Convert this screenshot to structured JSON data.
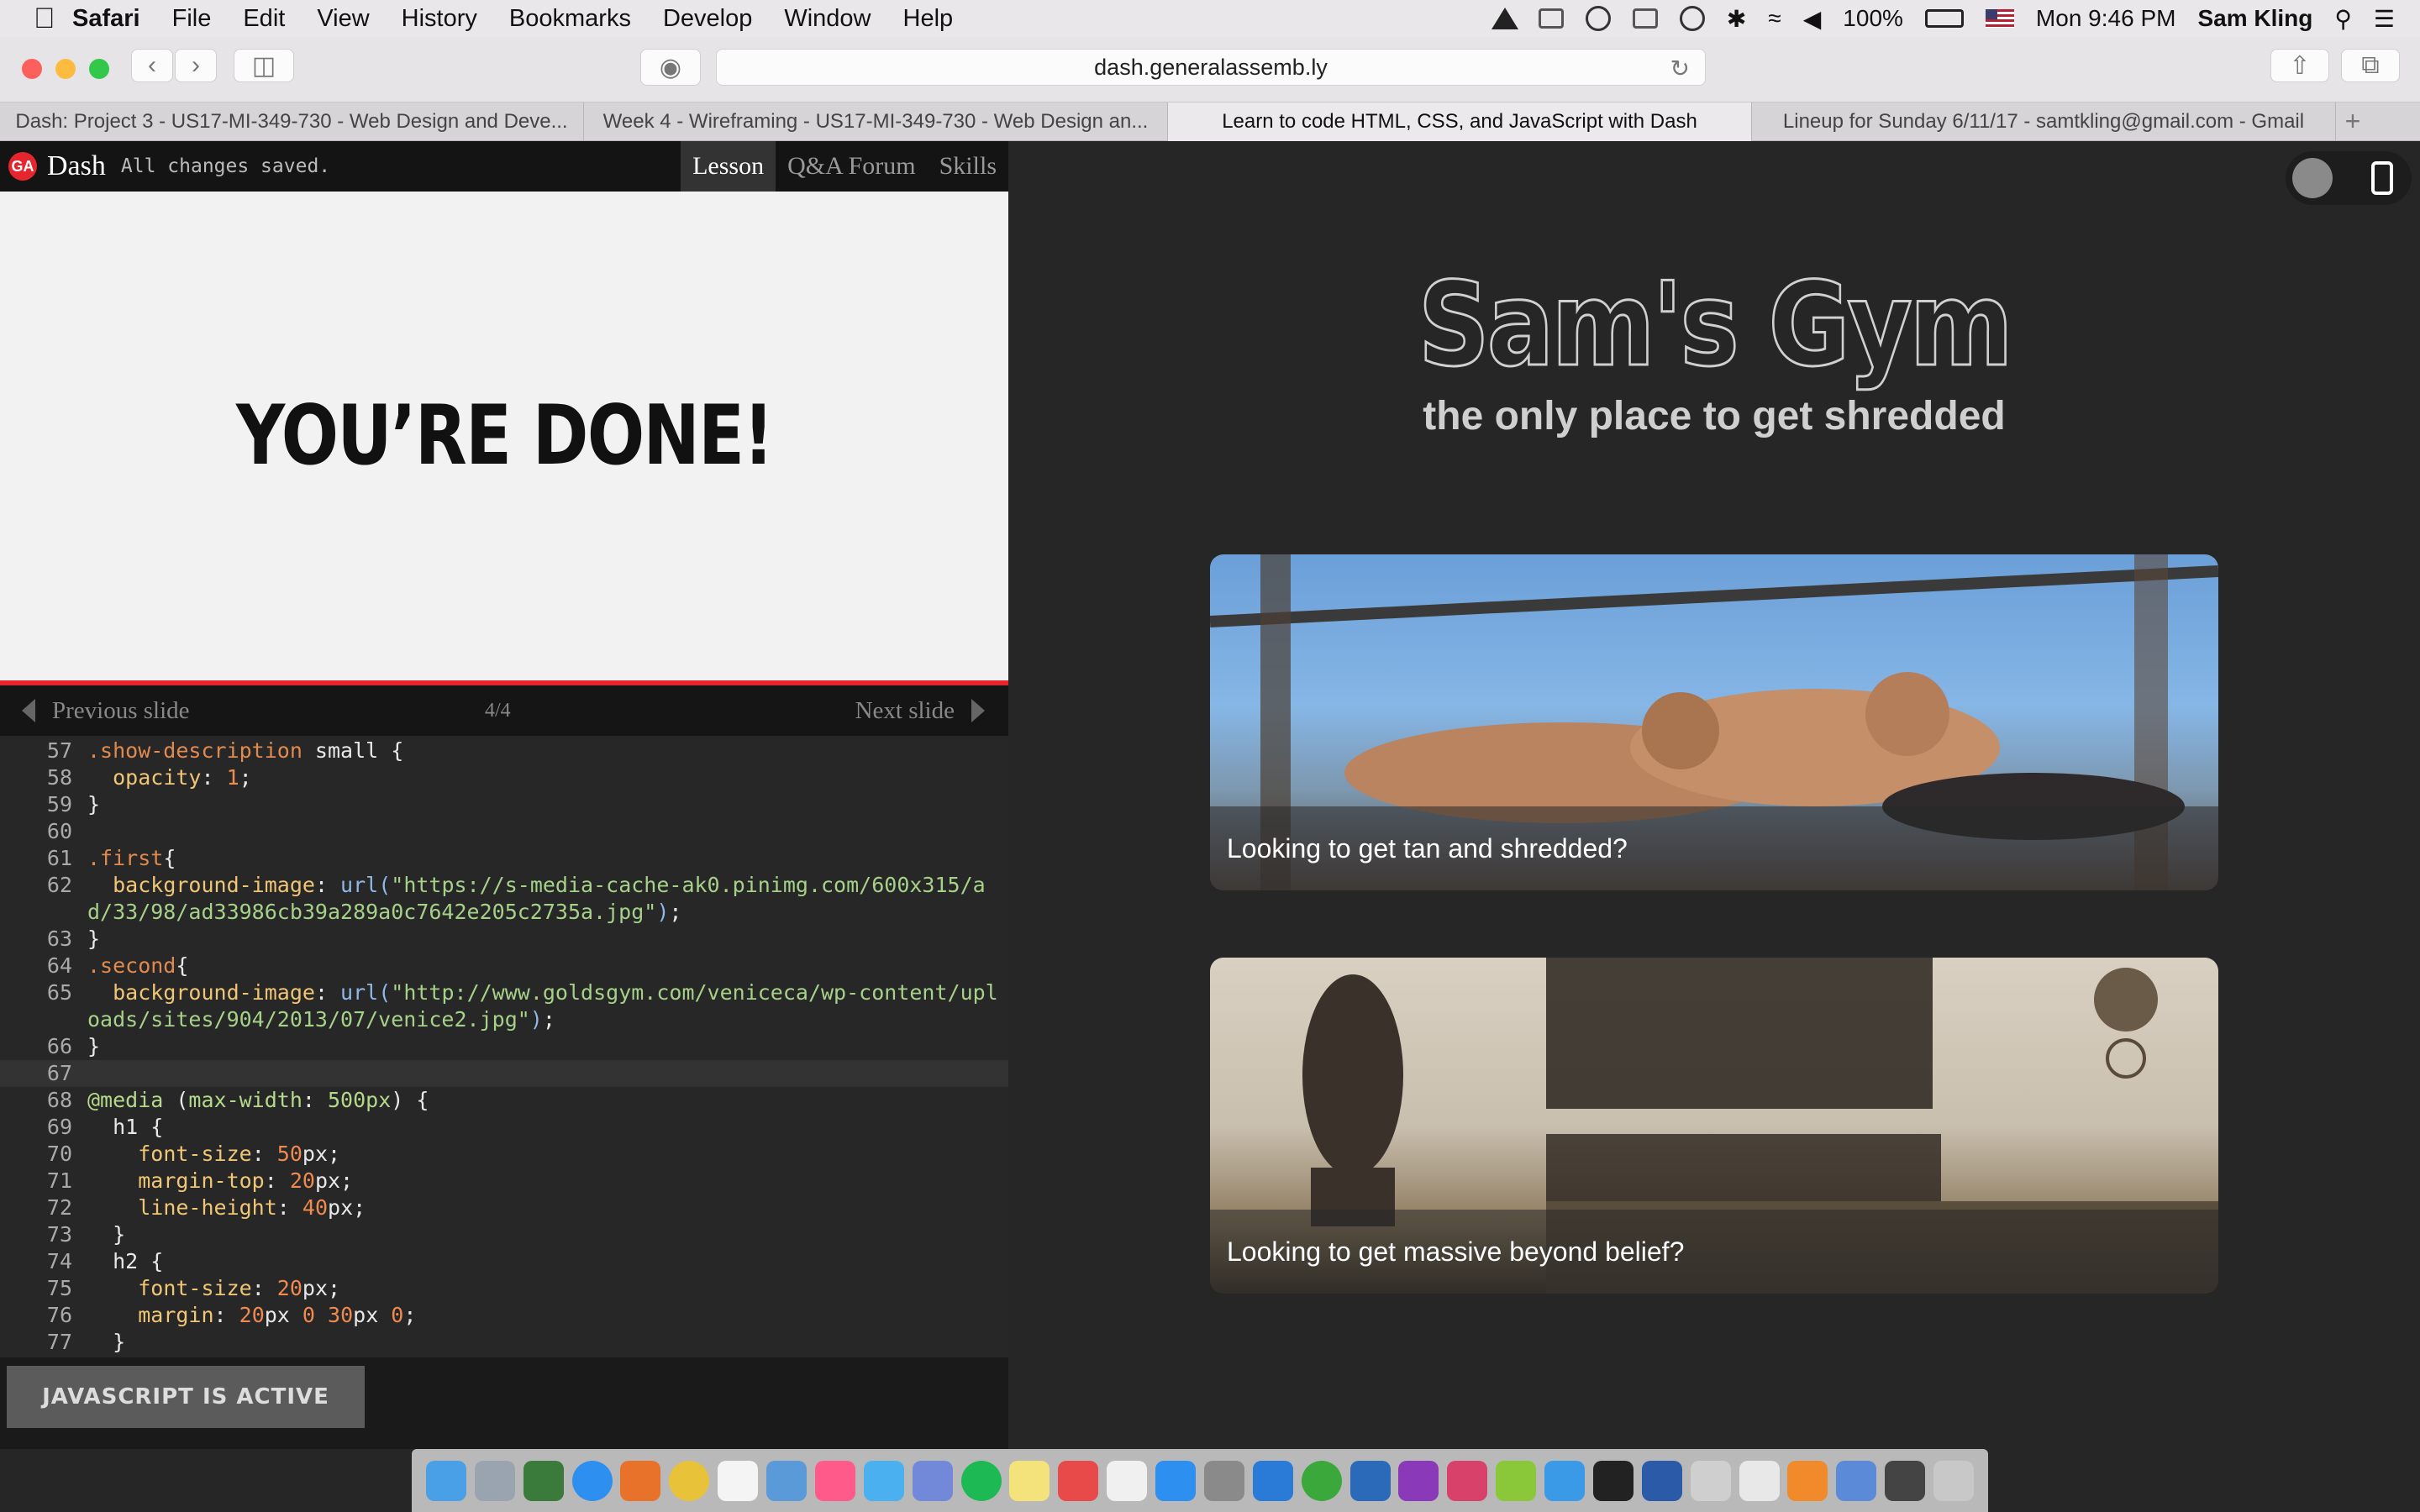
{
  "menubar": {
    "app": "Safari",
    "items": [
      "File",
      "Edit",
      "View",
      "History",
      "Bookmarks",
      "Develop",
      "Window",
      "Help"
    ],
    "battery": "100%",
    "clock": "Mon 9:46 PM",
    "user": "Sam Kling"
  },
  "browser": {
    "url": "dash.generalassemb.ly",
    "tabs": [
      {
        "title": "Dash: Project 3 - US17-MI-349-730 - Web Design and Deve...",
        "active": false
      },
      {
        "title": "Week 4 - Wireframing - US17-MI-349-730 - Web Design an...",
        "active": false
      },
      {
        "title": "Learn to code HTML, CSS, and JavaScript with Dash",
        "active": true
      },
      {
        "title": "Lineup for Sunday 6/11/17 - samtkling@gmail.com - Gmail",
        "active": false
      }
    ]
  },
  "dash": {
    "logo_text": "GA",
    "brand": "Dash",
    "status": "All changes saved.",
    "nav": [
      "Lesson",
      "Q&A Forum",
      "Skills"
    ],
    "active_nav": "Lesson"
  },
  "slide": {
    "heading": "YOU’RE DONE!",
    "prev": "Previous slide",
    "counter": "4/4",
    "next": "Next slide"
  },
  "editor": {
    "lines": [
      {
        "n": "57",
        "fold": true,
        "parts": [
          [
            "c-sel",
            ".show-description"
          ],
          [
            "",
            " small {"
          ]
        ]
      },
      {
        "n": "58",
        "parts": [
          [
            "",
            "  "
          ],
          [
            "c-prop",
            "opacity"
          ],
          [
            "",
            ": "
          ],
          [
            "c-num",
            "1"
          ],
          [
            "",
            ";"
          ]
        ]
      },
      {
        "n": "59",
        "parts": [
          [
            "",
            "}"
          ]
        ]
      },
      {
        "n": "60",
        "parts": [
          [
            "",
            ""
          ]
        ]
      },
      {
        "n": "61",
        "fold": true,
        "parts": [
          [
            "c-sel",
            ".first"
          ],
          [
            "",
            "{"
          ]
        ]
      },
      {
        "n": "62",
        "parts": [
          [
            "",
            "  "
          ],
          [
            "c-prop",
            "background-image"
          ],
          [
            "",
            ": "
          ],
          [
            "c-fn",
            "url("
          ],
          [
            "c-str",
            "\"https://s-media-cache-ak0.pinimg.com/600x315/ad/33/98/ad33986cb39a289a0c7642e205c2735a.jpg\""
          ],
          [
            "c-fn",
            ")"
          ],
          [
            "",
            ";"
          ]
        ]
      },
      {
        "n": "63",
        "parts": [
          [
            "",
            "}"
          ]
        ]
      },
      {
        "n": "64",
        "fold": true,
        "parts": [
          [
            "c-sel",
            ".second"
          ],
          [
            "",
            "{"
          ]
        ]
      },
      {
        "n": "65",
        "parts": [
          [
            "",
            "  "
          ],
          [
            "c-prop",
            "background-image"
          ],
          [
            "",
            ": "
          ],
          [
            "c-fn",
            "url("
          ],
          [
            "c-str",
            "\"http://www.goldsgym.com/veniceca/wp-content/uploads/sites/904/2013/07/venice2.jpg\""
          ],
          [
            "c-fn",
            ")"
          ],
          [
            "",
            ";"
          ]
        ]
      },
      {
        "n": "66",
        "parts": [
          [
            "",
            "}"
          ]
        ]
      },
      {
        "n": "67",
        "highlight": true,
        "parts": [
          [
            "",
            ""
          ]
        ]
      },
      {
        "n": "68",
        "fold": true,
        "parts": [
          [
            "c-at",
            "@media"
          ],
          [
            "",
            " ("
          ],
          [
            "c-at",
            "max-width"
          ],
          [
            "",
            ": "
          ],
          [
            "c-at",
            "500px"
          ],
          [
            "",
            ") {"
          ]
        ]
      },
      {
        "n": "69",
        "fold": true,
        "parts": [
          [
            "",
            "  h1 {"
          ]
        ]
      },
      {
        "n": "70",
        "parts": [
          [
            "",
            "    "
          ],
          [
            "c-prop",
            "font-size"
          ],
          [
            "",
            ": "
          ],
          [
            "c-num",
            "50"
          ],
          [
            "",
            "px;"
          ]
        ]
      },
      {
        "n": "71",
        "parts": [
          [
            "",
            "    "
          ],
          [
            "c-prop",
            "margin-top"
          ],
          [
            "",
            ": "
          ],
          [
            "c-num",
            "20"
          ],
          [
            "",
            "px;"
          ]
        ]
      },
      {
        "n": "72",
        "parts": [
          [
            "",
            "    "
          ],
          [
            "c-prop",
            "line-height"
          ],
          [
            "",
            ": "
          ],
          [
            "c-num",
            "40"
          ],
          [
            "",
            "px;"
          ]
        ]
      },
      {
        "n": "73",
        "parts": [
          [
            "",
            "  }"
          ]
        ]
      },
      {
        "n": "74",
        "fold": true,
        "parts": [
          [
            "",
            "  h2 {"
          ]
        ]
      },
      {
        "n": "75",
        "parts": [
          [
            "",
            "    "
          ],
          [
            "c-prop",
            "font-size"
          ],
          [
            "",
            ": "
          ],
          [
            "c-num",
            "20"
          ],
          [
            "",
            "px;"
          ]
        ]
      },
      {
        "n": "76",
        "parts": [
          [
            "",
            "    "
          ],
          [
            "c-prop",
            "margin"
          ],
          [
            "",
            ": "
          ],
          [
            "c-num",
            "20"
          ],
          [
            "",
            "px "
          ],
          [
            "c-num",
            "0"
          ],
          [
            "",
            " "
          ],
          [
            "c-num",
            "30"
          ],
          [
            "",
            "px "
          ],
          [
            "c-num",
            "0"
          ],
          [
            "",
            ";"
          ]
        ]
      },
      {
        "n": "77",
        "parts": [
          [
            "",
            "  }"
          ]
        ]
      }
    ]
  },
  "js_status": "JAVASCRIPT IS ACTIVE",
  "preview": {
    "title": "Sam's Gym",
    "subtitle": "the only place to get shredded",
    "cards": [
      {
        "caption": "Looking to get tan and shredded?"
      },
      {
        "caption": "Looking to get massive beyond belief?"
      }
    ]
  },
  "colors": {
    "accent": "#e5262e",
    "preview_bg": "#262626",
    "editor_bg": "#272727"
  },
  "icons": {
    "status": [
      "notification-icon",
      "display-icon",
      "sync-icon",
      "menu-extra-icon",
      "time-machine-icon",
      "bluetooth-icon",
      "wifi-icon",
      "volume-icon",
      "battery-icon",
      "flag-icon",
      "search-icon",
      "list-icon"
    ],
    "dock": [
      "finder-icon",
      "launchpad-icon",
      "dashboard-icon",
      "safari-icon",
      "firefox-icon",
      "chrome-icon",
      "calendar-icon",
      "preview-icon",
      "itunes-icon",
      "messages-icon",
      "discord-icon",
      "spotify-icon",
      "notes-icon",
      "photo-booth-icon",
      "textedit-icon",
      "app-store-icon",
      "system-preferences-icon",
      "vscode-icon",
      "activity-icon",
      "r-icon",
      "phpstorm-icon",
      "intellij-icon",
      "android-studio-icon",
      "xcode-icon",
      "terminal-icon",
      "virtualbox-icon",
      "preview2-icon",
      "slack-icon",
      "sublime-icon",
      "downloads-icon",
      "screen-icon",
      "trash-icon"
    ]
  }
}
